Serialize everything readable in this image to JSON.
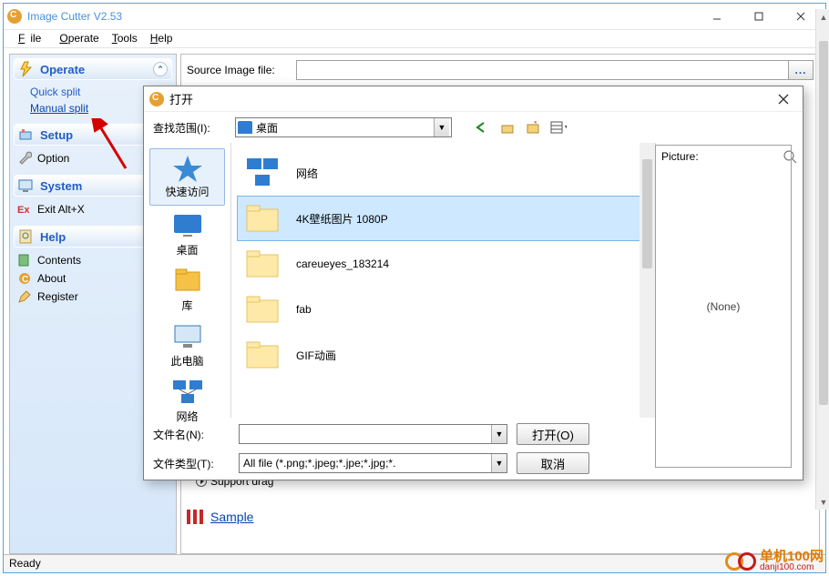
{
  "window": {
    "title": "Image Cutter V2.53"
  },
  "menubar": {
    "file": "File",
    "operate": "Operate",
    "tools": "Tools",
    "help": "Help"
  },
  "sidebar": {
    "sections": [
      {
        "title": "Operate",
        "items": [
          {
            "label": "Quick split",
            "link": false
          },
          {
            "label": "Manual split",
            "link": true
          }
        ]
      },
      {
        "title": "Setup",
        "items": [
          {
            "label": "Option",
            "icon": "wrench"
          }
        ]
      },
      {
        "title": "System",
        "items": [
          {
            "label": "Exit  Alt+X",
            "icon": "exit"
          }
        ]
      },
      {
        "title": "Help",
        "items": [
          {
            "label": "Contents",
            "icon": "book"
          },
          {
            "label": "About",
            "icon": "app"
          },
          {
            "label": "Register",
            "icon": "pencil"
          }
        ]
      }
    ]
  },
  "source": {
    "label": "Source Image file:",
    "value": "",
    "browse": "..."
  },
  "support_drag": "Support drag",
  "sample": "Sample",
  "statusbar": "Ready",
  "dialog": {
    "title": "打开",
    "lookin_label": "查找范围(I):",
    "lookin_value": "桌面",
    "places": [
      {
        "label": "快速访问",
        "icon": "star"
      },
      {
        "label": "桌面",
        "icon": "desktop",
        "selected": false
      },
      {
        "label": "库",
        "icon": "libraries"
      },
      {
        "label": "此电脑",
        "icon": "computer"
      },
      {
        "label": "网络",
        "icon": "network"
      }
    ],
    "files": [
      {
        "name": "网络",
        "icon": "network-item",
        "highlight": false
      },
      {
        "name": "4K壁纸图片 1080P",
        "icon": "folder",
        "highlight": true
      },
      {
        "name": "careueyes_183214",
        "icon": "folder",
        "highlight": false
      },
      {
        "name": "fab",
        "icon": "folder",
        "highlight": false
      },
      {
        "name": "GIF动画",
        "icon": "folder-gif",
        "highlight": false
      }
    ],
    "preview_label": "Picture:",
    "preview_value": "(None)",
    "filename_label": "文件名(N):",
    "filename_value": "",
    "filetype_label": "文件类型(T):",
    "filetype_value": "All file (*.png;*.jpeg;*.jpe;*.jpg;*.",
    "open_btn": "打开(O)",
    "cancel_btn": "取消"
  },
  "watermark": {
    "cn": "单机100网",
    "dom": "danji100.com"
  }
}
